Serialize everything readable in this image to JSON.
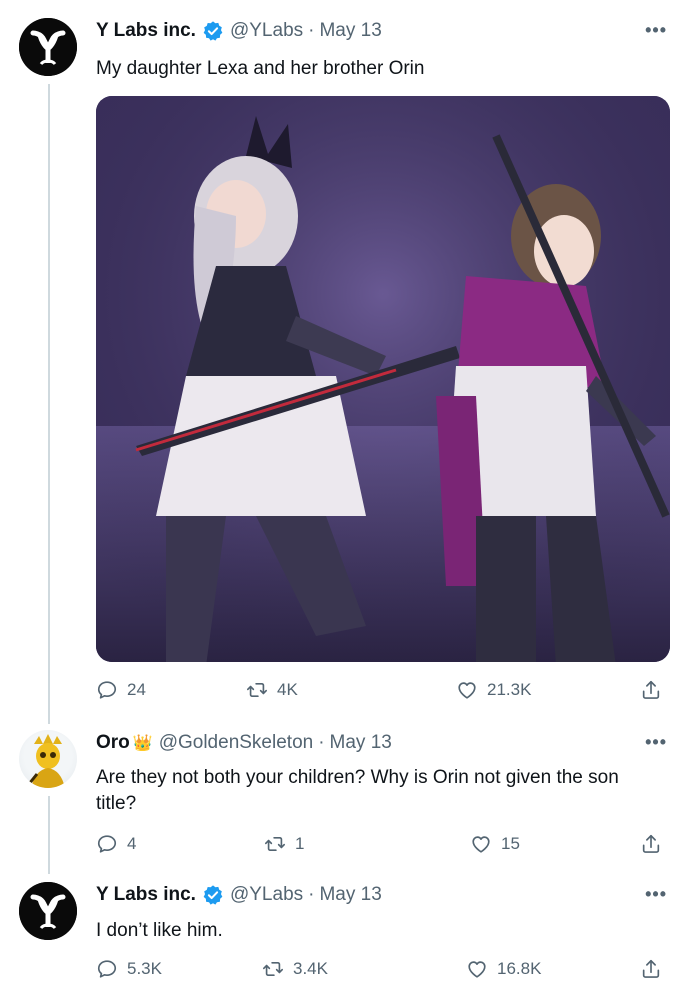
{
  "tweets": [
    {
      "name": "Y Labs inc.",
      "handle": "@YLabs",
      "separator": "·",
      "date": "May 13",
      "text": "My daughter Lexa and her brother Orin",
      "stats": {
        "replies": "24",
        "retweets": "4K",
        "likes": "21.3K"
      },
      "avatar_icon": "y-labs-logo-icon",
      "verified_color": "#1d9bf0"
    },
    {
      "name": "Oro",
      "name_emoji": "👑",
      "handle": "@GoldenSkeleton",
      "separator": "·",
      "date": "May 13",
      "text_line1": "Are they not both your children? Why is Orin not given the son",
      "text_line2": "title?",
      "stats": {
        "replies": "4",
        "retweets": "1",
        "likes": "15"
      },
      "avatar_icon": "golden-skeleton-avatar"
    },
    {
      "name": "Y Labs inc.",
      "handle": "@YLabs",
      "separator": "·",
      "date": "May 13",
      "text": "I don’t like him.",
      "stats": {
        "replies": "5.3K",
        "retweets": "3.4K",
        "likes": "16.8K"
      },
      "avatar_icon": "y-labs-logo-icon",
      "verified_color": "#1d9bf0"
    }
  ],
  "more_label": "•••",
  "colors": {
    "text": "#0f1419",
    "secondary": "#536471",
    "thread": "#cfd9de"
  }
}
